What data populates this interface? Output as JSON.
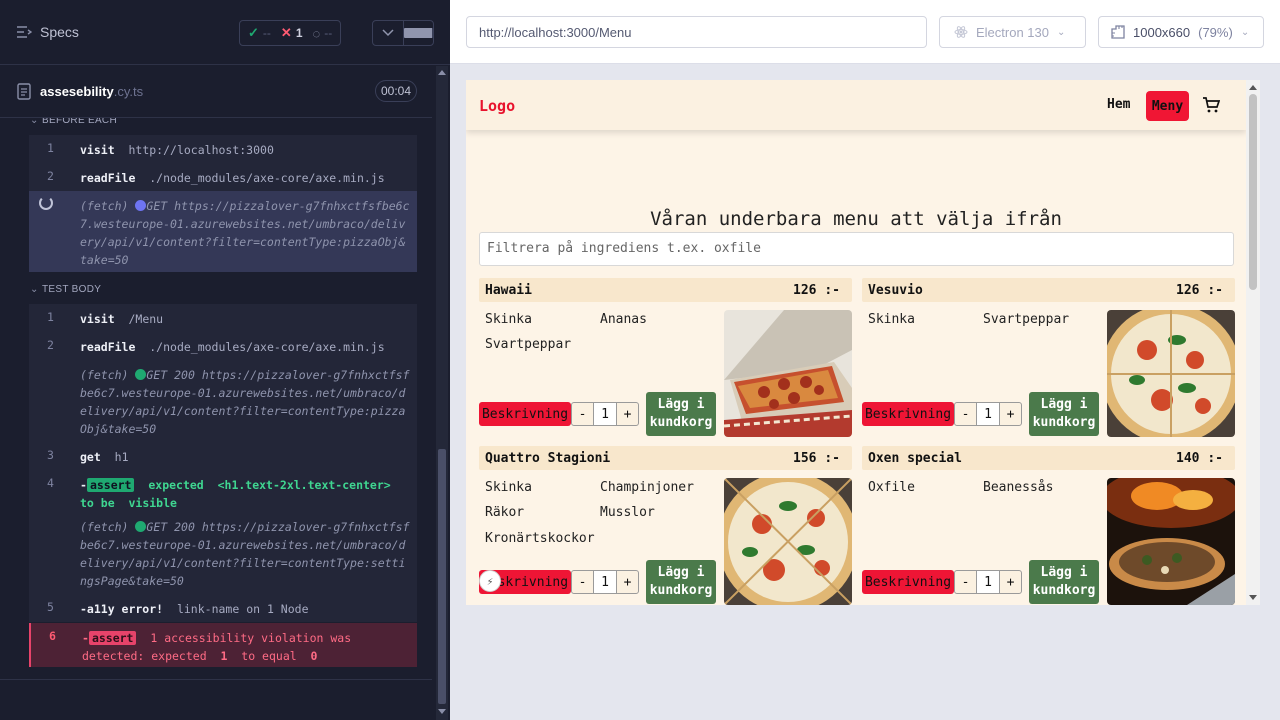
{
  "reporter": {
    "specs_label": "Specs",
    "stats": {
      "passed": "--",
      "failed": "1",
      "pending": "--"
    },
    "file": {
      "name": "assesebility",
      "ext": ".cy.ts",
      "duration": "00:04"
    },
    "before_each": {
      "label": "BEFORE EACH",
      "commands": [
        {
          "num": "1",
          "name": "visit",
          "msg": "http://localhost:3000"
        },
        {
          "num": "2",
          "name": "readFile",
          "msg": "./node_modules/axe-core/axe.min.js"
        }
      ],
      "fetch_pending": {
        "label": "(fetch)",
        "method": "GET",
        "url": "https://pizzalover-g7fnhxctfsfbe6c7.westeurope-01.azurewebsites.net/umbraco/delivery/api/v1/content?filter=contentType:pizzaObj&take=50"
      }
    },
    "test_body": {
      "label": "TEST BODY",
      "cmd1": {
        "num": "1",
        "name": "visit",
        "msg": "/Menu"
      },
      "cmd2": {
        "num": "2",
        "name": "readFile",
        "msg": "./node_modules/axe-core/axe.min.js"
      },
      "fetch1": {
        "label": "(fetch)",
        "method": "GET 200",
        "url": "https://pizzalover-g7fnhxctfsfbe6c7.westeurope-01.azurewebsites.net/umbraco/delivery/api/v1/content?filter=contentType:pizzaObj&take=50"
      },
      "cmd3": {
        "num": "3",
        "name": "get",
        "msg": "h1"
      },
      "cmd4": {
        "num": "4",
        "prefix": "-",
        "badge": "assert",
        "expected": "expected",
        "selector": "<h1.text-2xl.text-center>",
        "tobe": "to be",
        "visible": "visible"
      },
      "fetch2": {
        "label": "(fetch)",
        "method": "GET 200",
        "url": "https://pizzalover-g7fnhxctfsfbe6c7.westeurope-01.azurewebsites.net/umbraco/delivery/api/v1/content?filter=contentType:settingsPage&take=50"
      },
      "cmd5": {
        "num": "5",
        "name": "-a11y error!",
        "msg": "link-name on 1 Node"
      },
      "cmd6": {
        "num": "6",
        "prefix": "-",
        "badge": "assert",
        "text1": "1 accessibility violation was detected: expected",
        "val1": "1",
        "text2": "to equal",
        "val2": "0"
      }
    }
  },
  "aut": {
    "url": "http://localhost:3000/Menu",
    "browser": "Electron 130",
    "viewport": "1000x660",
    "scale": "(79%)"
  },
  "app": {
    "logo": "Logo",
    "nav": {
      "home": "Hem",
      "menu": "Meny"
    },
    "title": "Våran underbara menu att välja ifrån",
    "filter_placeholder": "Filtrera på ingrediens t.ex. oxfile",
    "buttons": {
      "description": "Beskrivning",
      "add_line1": "Lägg i",
      "add_line2": "kundkorg",
      "minus": "-",
      "plus": "+",
      "qty": "1"
    },
    "pizzas": [
      {
        "name": "Hawaii",
        "price": "126 :-",
        "ingredients": [
          "Skinka",
          "Ananas",
          "Svartpeppar"
        ]
      },
      {
        "name": "Vesuvio",
        "price": "126 :-",
        "ingredients": [
          "Skinka",
          "Svartpeppar"
        ]
      },
      {
        "name": "Quattro Stagioni",
        "price": "156 :-",
        "ingredients": [
          "Skinka",
          "Champinjoner",
          "Räkor",
          "Musslor",
          "Kronärtskockor"
        ]
      },
      {
        "name": "Oxen special",
        "price": "140 :-",
        "ingredients": [
          "Oxfile",
          "Beanessås"
        ]
      }
    ]
  },
  "colors": {
    "accent_red": "#f01634",
    "add_green": "#4b7a4b",
    "pass": "#1fa971",
    "fail": "#ff5b72"
  }
}
